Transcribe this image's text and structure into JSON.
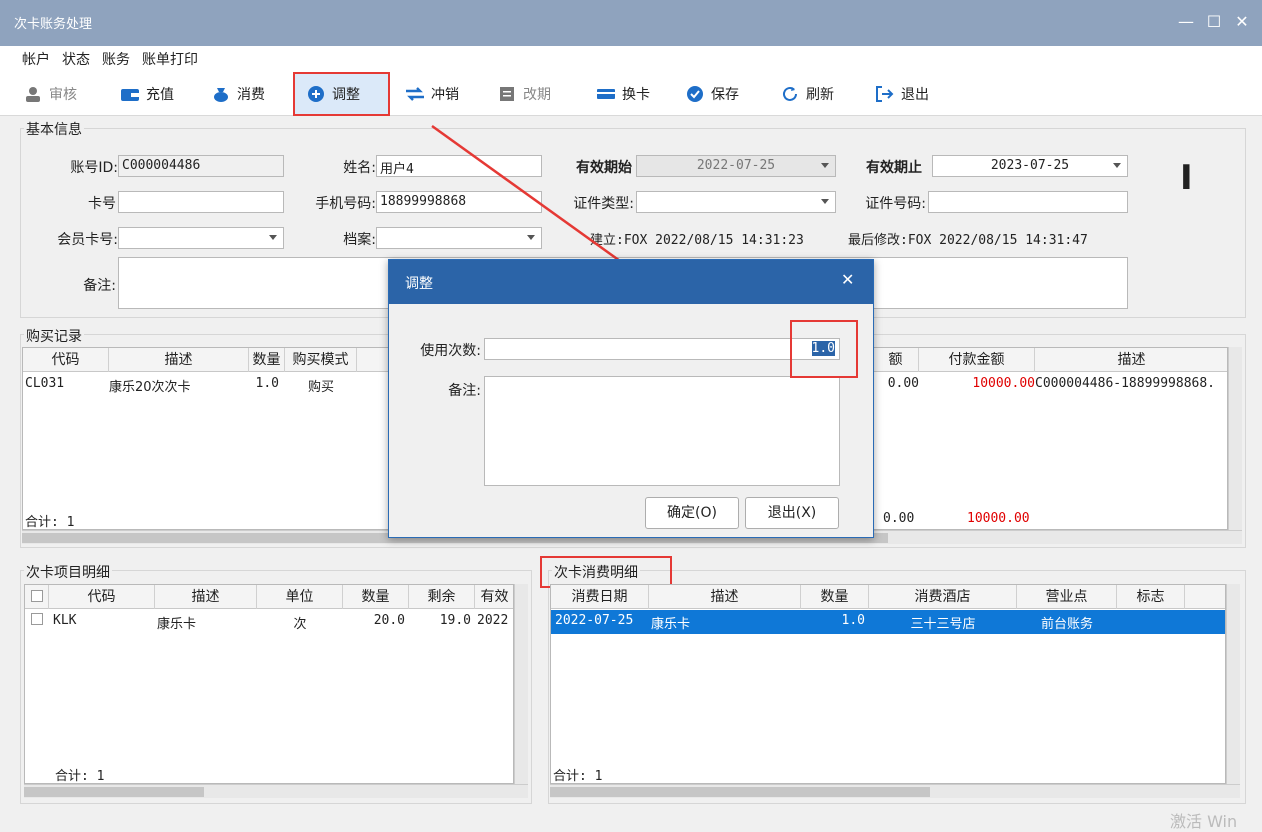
{
  "window": {
    "title": "次卡账务处理",
    "min": "—",
    "max": "☐",
    "close": "✕"
  },
  "menu": [
    "帐户",
    "状态",
    "账务",
    "账单打印"
  ],
  "toolbar": [
    {
      "label": "审核",
      "icon": "user-icon",
      "disabled": true
    },
    {
      "label": "充值",
      "icon": "wallet-icon"
    },
    {
      "label": "消费",
      "icon": "bag-icon"
    },
    {
      "label": "调整",
      "icon": "plus-circle-icon"
    },
    {
      "label": "冲销",
      "icon": "swap-icon"
    },
    {
      "label": "改期",
      "icon": "calendar-icon",
      "disabled": true
    },
    {
      "label": "换卡",
      "icon": "card-icon"
    },
    {
      "label": "保存",
      "icon": "check-circle-icon"
    },
    {
      "label": "刷新",
      "icon": "refresh-icon"
    },
    {
      "label": "退出",
      "icon": "exit-icon"
    }
  ],
  "basic": {
    "title": "基本信息",
    "account_id_label": "账号ID:",
    "account_id": "C000004486",
    "name_label": "姓名:",
    "name": "用户4",
    "valid_start_label": "有效期始",
    "valid_start": "2022-07-25",
    "valid_end_label": "有效期止",
    "valid_end": "2023-07-25",
    "card_no_label": "卡号",
    "card_no": "",
    "phone_label": "手机号码:",
    "phone": "18899998868",
    "id_type_label": "证件类型:",
    "id_type": "",
    "id_no_label": "证件号码:",
    "id_no": "",
    "member_card_label": "会员卡号:",
    "member_card": "",
    "file_label": "档案:",
    "file": "",
    "created": "建立:FOX  2022/08/15 14:31:23",
    "modified": "最后修改:FOX  2022/08/15 14:31:47",
    "remark_label": "备注:",
    "remark": "",
    "cursor": "I"
  },
  "purchase": {
    "title": "购买记录",
    "cols_left": [
      "代码",
      "描述",
      "数量",
      "购买模式"
    ],
    "cols_right": [
      "额",
      "付款金额",
      "描述"
    ],
    "row_left": [
      "CL031",
      "康乐20次次卡",
      "1.0",
      "购买"
    ],
    "row_right": [
      "0.00",
      "10000.00",
      "C000004486-18899998868."
    ],
    "total": "合计:  1",
    "total_right": [
      "0.00",
      "10000.00"
    ]
  },
  "items": {
    "title": "次卡项目明细",
    "cols": [
      "代码",
      "描述",
      "单位",
      "数量",
      "剩余",
      "有效"
    ],
    "rows": [
      [
        "KLK",
        "康乐卡",
        "次",
        "20.0",
        "19.0",
        "2022"
      ]
    ],
    "total": "合计:  1"
  },
  "consume": {
    "title": "次卡消费明细",
    "cols": [
      "消费日期",
      "描述",
      "数量",
      "消费酒店",
      "营业点",
      "标志"
    ],
    "rows": [
      [
        "2022-07-25",
        "康乐卡",
        "1.0",
        "三十三号店",
        "前台账务",
        ""
      ]
    ],
    "total": "合计:  1"
  },
  "dialog": {
    "title": "调整",
    "close": "✕",
    "count_label": "使用次数:",
    "count": "1.0",
    "remark_label": "备注:",
    "remark": "",
    "ok": "确定(O)",
    "cancel": "退出(X)"
  },
  "watermark": "激活 Win",
  "colors": {
    "titlebar": "#8fa3be",
    "dialog_title": "#2b64a8",
    "highlight": "#e53935",
    "selected": "#0f78d7",
    "amount": "#e00000"
  }
}
